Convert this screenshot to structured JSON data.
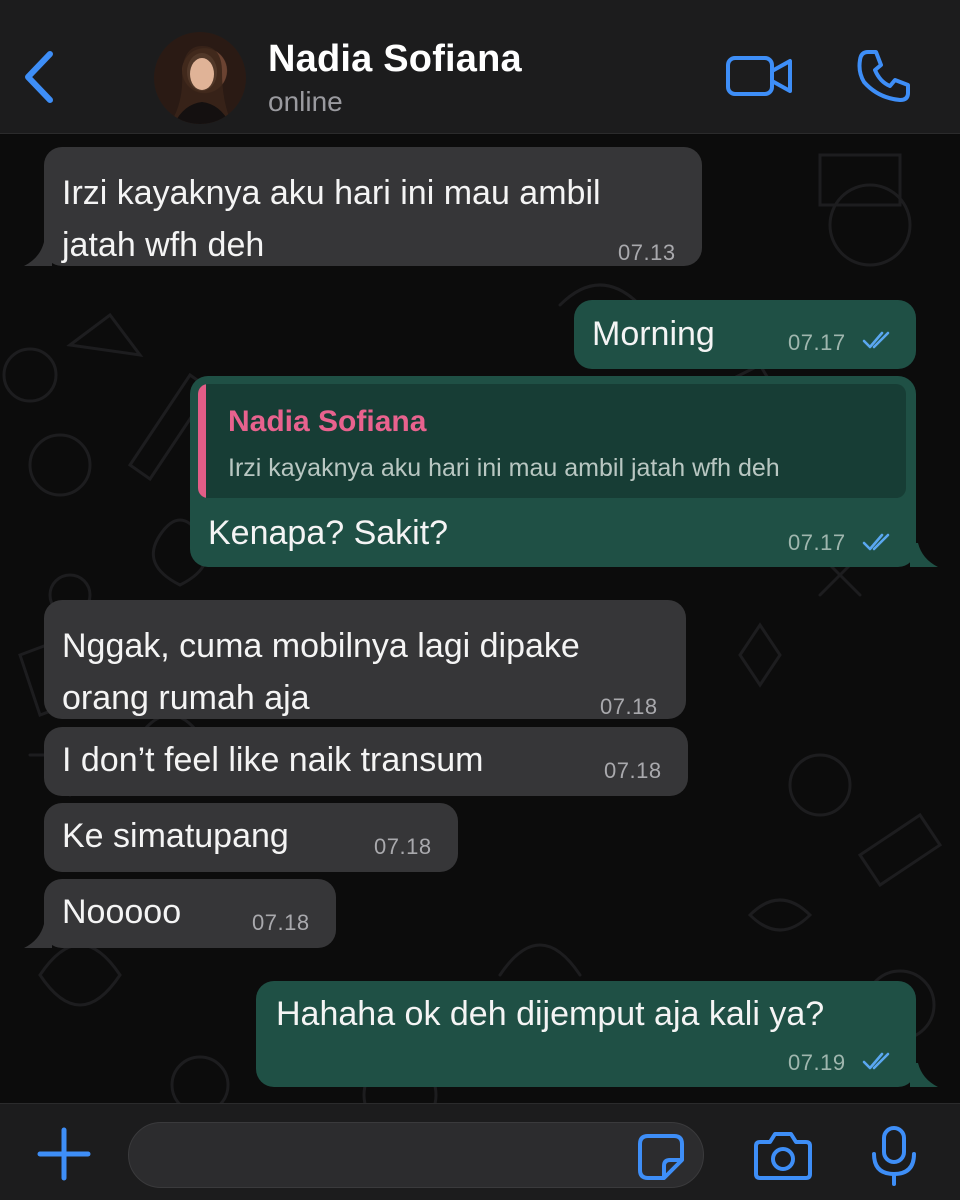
{
  "colors": {
    "accent": "#3e8ef7",
    "incoming_bubble": "#363638",
    "outgoing_bubble": "#1f5045",
    "quote_name": "#e8628e",
    "read_ticks": "#5aa7f0"
  },
  "header": {
    "contact_name": "Nadia Sofiana",
    "status": "online",
    "icons": [
      "back-chevron-icon",
      "video-camera-icon",
      "phone-icon"
    ]
  },
  "messages": [
    {
      "direction": "in",
      "lines": [
        "Irzi kayaknya aku hari ini mau ambil",
        "jatah wfh deh"
      ],
      "time": "07.13"
    },
    {
      "direction": "out",
      "lines": [
        "Morning"
      ],
      "time": "07.17",
      "read": true
    },
    {
      "direction": "out",
      "quote": {
        "author": "Nadia Sofiana",
        "text": "Irzi kayaknya aku hari ini mau ambil jatah wfh deh"
      },
      "lines": [
        "Kenapa? Sakit?"
      ],
      "time": "07.17",
      "read": true
    },
    {
      "direction": "in",
      "lines": [
        "Nggak, cuma mobilnya lagi dipake",
        "orang rumah aja"
      ],
      "time": "07.18"
    },
    {
      "direction": "in",
      "lines": [
        "I don’t feel like naik transum"
      ],
      "time": "07.18"
    },
    {
      "direction": "in",
      "lines": [
        "Ke simatupang"
      ],
      "time": "07.18"
    },
    {
      "direction": "in",
      "lines": [
        "Nooooo"
      ],
      "time": "07.18"
    },
    {
      "direction": "out",
      "lines": [
        "Hahaha ok deh dijemput aja kali ya?"
      ],
      "time": "07.19",
      "read": true
    }
  ],
  "composer": {
    "placeholder": "",
    "icons": [
      "plus-icon",
      "sticker-icon",
      "camera-icon",
      "microphone-icon"
    ]
  }
}
